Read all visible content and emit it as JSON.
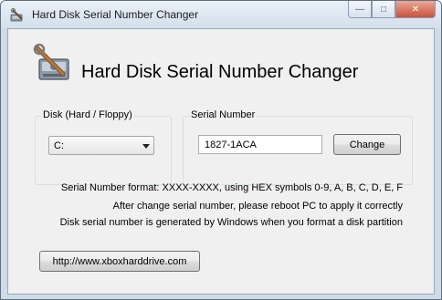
{
  "window": {
    "title": "Hard Disk Serial Number Changer",
    "controls": [
      "minimize",
      "maximize",
      "close"
    ]
  },
  "header": {
    "title": "Hard Disk Serial Number Changer",
    "icon": "disk-wrench-icon"
  },
  "disk_group": {
    "label": "Disk (Hard / Floppy)",
    "selected": "C:"
  },
  "serial_group": {
    "label": "Serial Number",
    "value": "1827-1ACA",
    "button_label": "Change"
  },
  "info": {
    "line1": "Serial Number format: XXXX-XXXX, using HEX symbols 0-9, A, B, C, D, E, F",
    "line2": "After change serial number, please reboot PC to apply it correctly",
    "line3": "Disk serial number is generated by Windows when you format a disk partition"
  },
  "link": {
    "label": "http://www.xboxharddrive.com"
  }
}
